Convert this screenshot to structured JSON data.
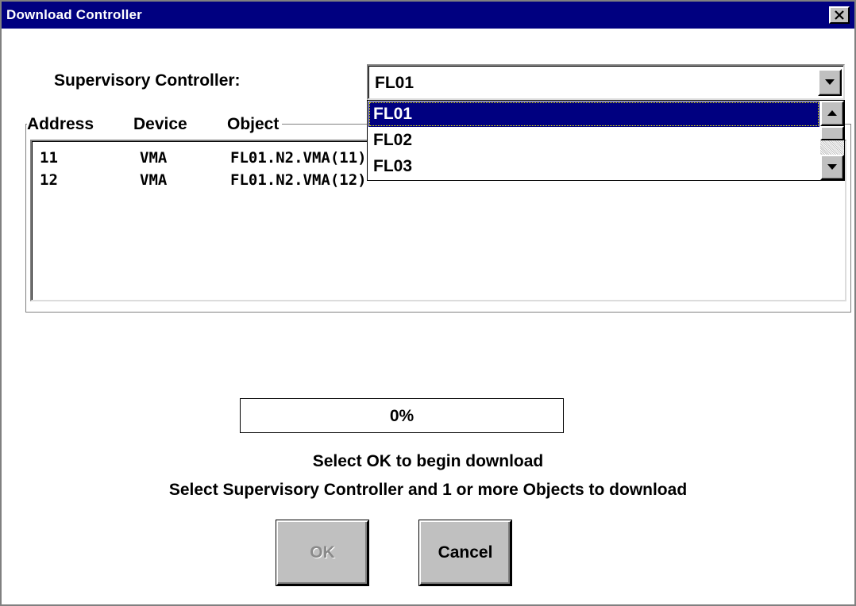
{
  "window": {
    "title": "Download Controller",
    "close_icon": "close-x-icon"
  },
  "supervisory": {
    "label": "Supervisory Controller:",
    "selected": "FL01",
    "options": [
      "FL01",
      "FL02",
      "FL03"
    ],
    "highlighted_index": 0
  },
  "objects": {
    "columns": [
      "Address",
      "Device",
      "Object"
    ],
    "rows": [
      {
        "address": "11",
        "device": "VMA",
        "object": "FL01.N2.VMA(11)"
      },
      {
        "address": "12",
        "device": "VMA",
        "object": "FL01.N2.VMA(12)"
      }
    ]
  },
  "progress": {
    "value": 0,
    "text": "0%"
  },
  "messages": {
    "line1": "Select OK to begin download",
    "line2": "Select Supervisory Controller and 1 or more Objects to download"
  },
  "buttons": {
    "ok": "OK",
    "ok_enabled": false,
    "cancel": "Cancel"
  },
  "colors": {
    "titlebar": "#000080",
    "selection": "#000080",
    "face": "#c0c0c0"
  }
}
